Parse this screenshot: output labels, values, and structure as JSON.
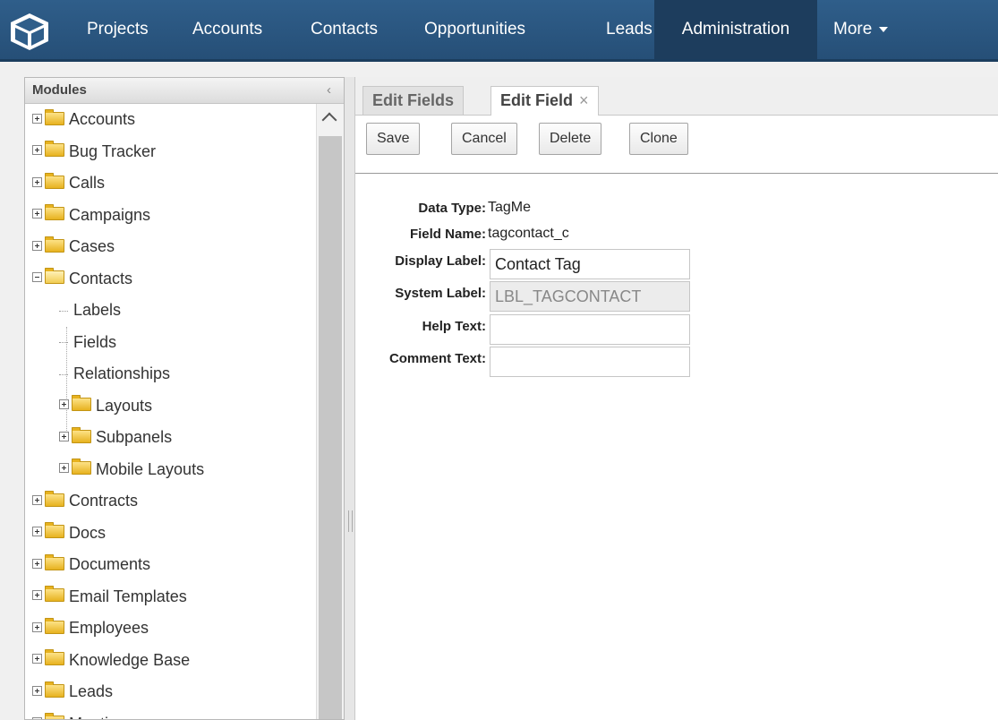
{
  "nav": {
    "items": [
      "Projects",
      "Accounts",
      "Contacts",
      "Opportunities",
      "Leads",
      "Administration"
    ],
    "active": "Administration",
    "more_label": "More"
  },
  "sidebar": {
    "title": "Modules",
    "collapse_glyph": "‹",
    "items": [
      {
        "label": "Accounts",
        "level": 0,
        "type": "folder",
        "expanded": false
      },
      {
        "label": "Bug Tracker",
        "level": 0,
        "type": "folder",
        "expanded": false
      },
      {
        "label": "Calls",
        "level": 0,
        "type": "folder",
        "expanded": false
      },
      {
        "label": "Campaigns",
        "level": 0,
        "type": "folder",
        "expanded": false
      },
      {
        "label": "Cases",
        "level": 0,
        "type": "folder",
        "expanded": false
      },
      {
        "label": "Contacts",
        "level": 0,
        "type": "folder",
        "expanded": true
      },
      {
        "label": "Labels",
        "level": 1,
        "type": "leaf"
      },
      {
        "label": "Fields",
        "level": 1,
        "type": "leaf"
      },
      {
        "label": "Relationships",
        "level": 1,
        "type": "leaf"
      },
      {
        "label": "Layouts",
        "level": 1,
        "type": "folder",
        "expanded": false
      },
      {
        "label": "Subpanels",
        "level": 1,
        "type": "folder",
        "expanded": false
      },
      {
        "label": "Mobile Layouts",
        "level": 1,
        "type": "folder",
        "expanded": false
      },
      {
        "label": "Contracts",
        "level": 0,
        "type": "folder",
        "expanded": false
      },
      {
        "label": "Docs",
        "level": 0,
        "type": "folder",
        "expanded": false
      },
      {
        "label": "Documents",
        "level": 0,
        "type": "folder",
        "expanded": false
      },
      {
        "label": "Email Templates",
        "level": 0,
        "type": "folder",
        "expanded": false
      },
      {
        "label": "Employees",
        "level": 0,
        "type": "folder",
        "expanded": false
      },
      {
        "label": "Knowledge Base",
        "level": 0,
        "type": "folder",
        "expanded": false
      },
      {
        "label": "Leads",
        "level": 0,
        "type": "folder",
        "expanded": false
      },
      {
        "label": "Meetings",
        "level": 0,
        "type": "folder",
        "expanded": false
      }
    ]
  },
  "tabs": [
    {
      "label": "Edit Fields",
      "active": false
    },
    {
      "label": "Edit Field",
      "active": true,
      "close": "×"
    }
  ],
  "toolbar": {
    "save_label": "Save",
    "cancel_label": "Cancel",
    "delete_label": "Delete",
    "clone_label": "Clone"
  },
  "form": {
    "data_type_label": "Data Type:",
    "data_type_value": "TagMe",
    "field_name_label": "Field Name:",
    "field_name_value": "tagcontact_c",
    "display_label_label": "Display Label:",
    "display_label_value": "Contact Tag",
    "system_label_label": "System Label:",
    "system_label_value": "LBL_TAGCONTACT",
    "help_text_label": "Help Text:",
    "help_text_value": "",
    "comment_text_label": "Comment Text:",
    "comment_text_value": ""
  },
  "colors": {
    "nav_bg": "#2f5e8a",
    "nav_active_bg": "#1d3d5d",
    "folder": "#e7b21f"
  }
}
